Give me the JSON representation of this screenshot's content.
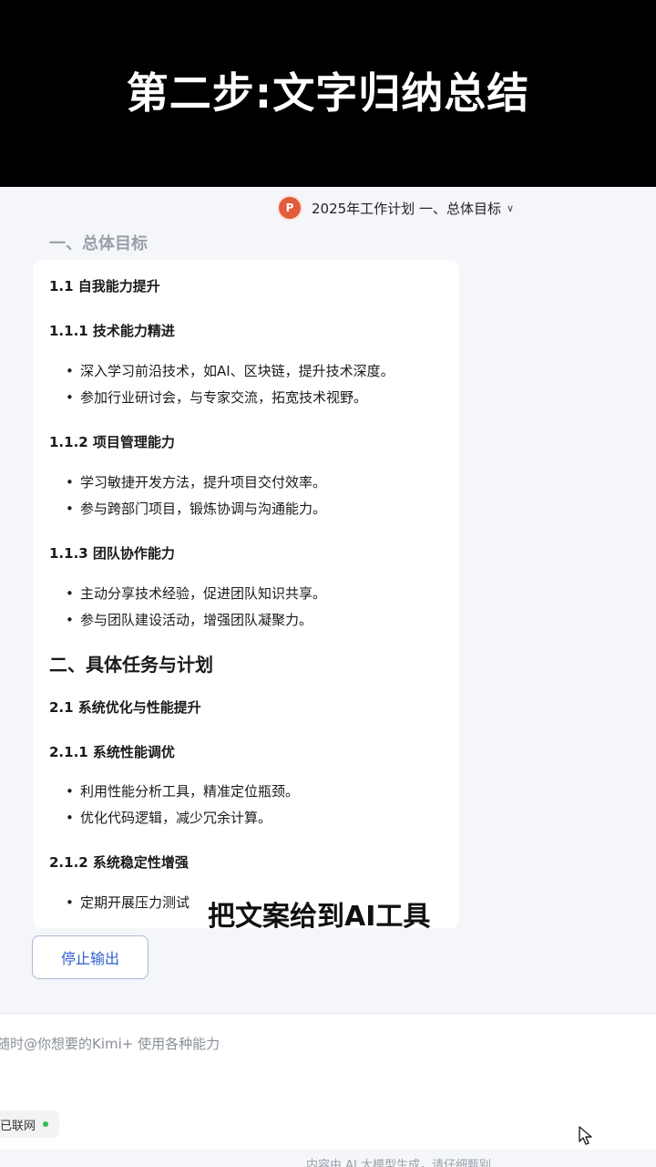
{
  "banner": {
    "title": "第二步:文字归纳总结"
  },
  "doc_selector": {
    "icon": "ppt-icon",
    "icon_text": "P",
    "label": "2025年工作计划 一、总体目标"
  },
  "faded_heading": "一、总体目标",
  "content": {
    "s1_1": "1.1 自我能力提升",
    "s1_1_1": "1.1.1 技术能力精进",
    "s1_1_1_items": [
      "深入学习前沿技术，如AI、区块链，提升技术深度。",
      "参加行业研讨会，与专家交流，拓宽技术视野。"
    ],
    "s1_1_2": "1.1.2 项目管理能力",
    "s1_1_2_items": [
      "学习敏捷开发方法，提升项目交付效率。",
      "参与跨部门项目，锻炼协调与沟通能力。"
    ],
    "s1_1_3": "1.1.3 团队协作能力",
    "s1_1_3_items": [
      "主动分享技术经验，促进团队知识共享。",
      "参与团队建设活动，增强团队凝聚力。"
    ],
    "s2": "二、具体任务与计划",
    "s2_1": "2.1 系统优化与性能提升",
    "s2_1_1": "2.1.1 系统性能调优",
    "s2_1_1_items": [
      "利用性能分析工具，精准定位瓶颈。",
      "优化代码逻辑，减少冗余计算。"
    ],
    "s2_1_2": "2.1.2 系统稳定性增强",
    "s2_1_2_items": [
      "定期开展压力测试"
    ]
  },
  "subtitle_overlay": "把文案给到AI工具",
  "stop_button": "停止输出",
  "input": {
    "placeholder": "随时@你想要的Kimi+ 使用各种能力"
  },
  "network_status": "已联网",
  "footer_note": "内容由 AI 大模型生成，请仔细甄别",
  "colors": {
    "accent": "#2d5fcf",
    "online": "#2fbf4f",
    "ppt": "#e35b3a"
  }
}
